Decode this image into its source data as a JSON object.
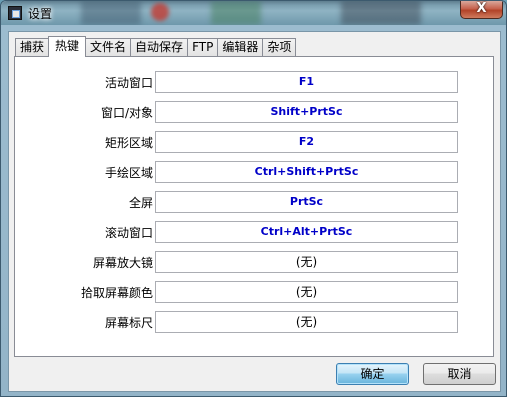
{
  "window": {
    "title": "设置",
    "close_label": "X"
  },
  "tabs": [
    {
      "label": "捕获",
      "active": false
    },
    {
      "label": "热键",
      "active": true
    },
    {
      "label": "文件名",
      "active": false
    },
    {
      "label": "自动保存",
      "active": false
    },
    {
      "label": "FTP",
      "active": false
    },
    {
      "label": "编辑器",
      "active": false
    },
    {
      "label": "杂项",
      "active": false
    }
  ],
  "hotkeys": [
    {
      "label": "活动窗口：",
      "value": "F1"
    },
    {
      "label": "窗口/对象：",
      "value": "Shift+PrtSc"
    },
    {
      "label": "矩形区域：",
      "value": "F2"
    },
    {
      "label": "手绘区域：",
      "value": "Ctrl+Shift+PrtSc"
    },
    {
      "label": "全屏：",
      "value": "PrtSc"
    },
    {
      "label": "滚动窗口：",
      "value": "Ctrl+Alt+PrtSc"
    },
    {
      "label": "屏幕放大镜：",
      "value": "(无)"
    },
    {
      "label": "拾取屏幕颜色：",
      "value": "(无)"
    },
    {
      "label": "屏幕标尺：",
      "value": "(无)"
    }
  ],
  "buttons": {
    "ok": "确定",
    "cancel": "取消"
  },
  "colors": {
    "hotkey_text": "#0000c8",
    "accent": "#3c7fb1"
  }
}
